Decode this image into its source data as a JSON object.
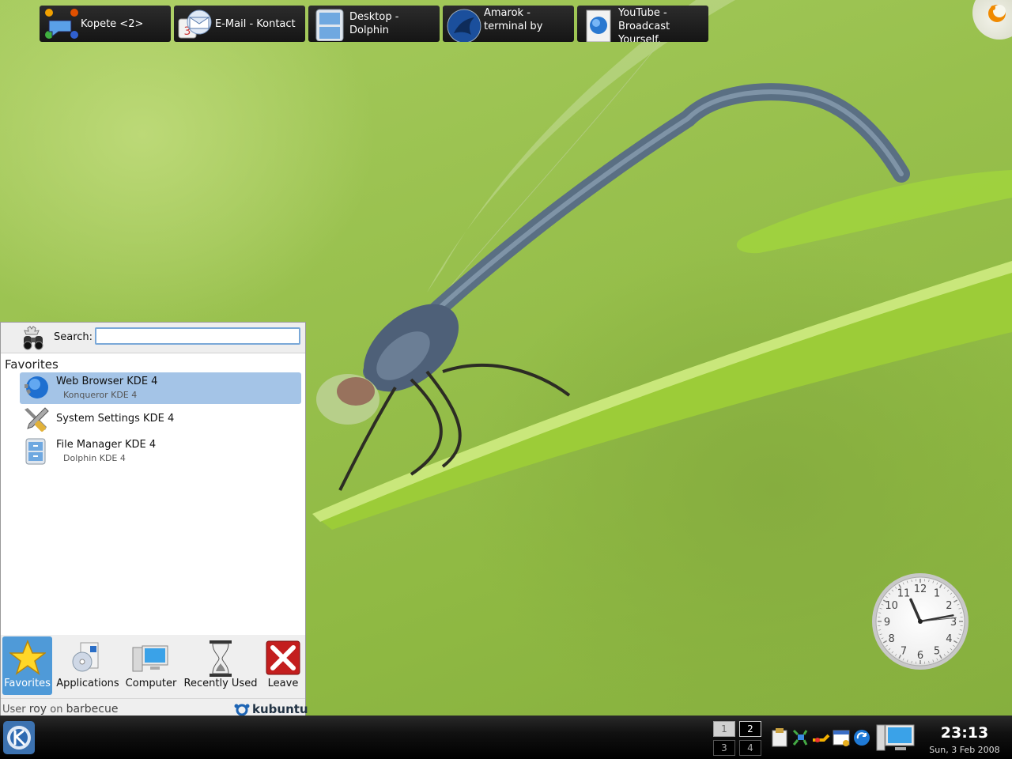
{
  "kickoff": {
    "search_label": "Search:",
    "search_value": "",
    "section_title": "Favorites",
    "favorites": [
      {
        "title": "Web Browser KDE 4",
        "subtitle": "Konqueror KDE 4",
        "icon": "globe-icon",
        "selected": true
      },
      {
        "title": "System Settings KDE 4",
        "subtitle": "",
        "icon": "settings-tools-icon",
        "selected": false
      },
      {
        "title": "File Manager KDE 4",
        "subtitle": "Dolphin KDE 4",
        "icon": "file-cabinet-icon",
        "selected": false
      }
    ],
    "tabs": [
      {
        "label": "Favorites",
        "icon": "star-icon",
        "active": true
      },
      {
        "label": "Applications",
        "icon": "applications-icon",
        "active": false
      },
      {
        "label": "Computer",
        "icon": "computer-icon",
        "active": false
      },
      {
        "label": "Recently Used",
        "icon": "hourglass-icon",
        "active": false
      },
      {
        "label": "Leave",
        "icon": "leave-icon",
        "active": false
      }
    ],
    "user_prefix": "User",
    "user_name": "roy",
    "user_on": "on",
    "host_name": "barbecue",
    "brand": "kubuntu"
  },
  "taskbar": {
    "tasks": [
      {
        "label": "Kopete <2>",
        "icon": "kopete-icon"
      },
      {
        "label": "E-Mail - Kontact",
        "icon": "kontact-icon"
      },
      {
        "label": "Desktop - Dolphin",
        "icon": "dolphin-icon"
      },
      {
        "label": "Amarok - terminal by",
        "icon": "amarok-icon"
      },
      {
        "label": "YouTube - Broadcast Yourself.",
        "icon": "konqueror-icon"
      }
    ],
    "pager": [
      "1",
      "2",
      "3",
      "4"
    ],
    "tray_icons": [
      "klipper-icon",
      "network-icon",
      "wireless-icon",
      "calendar-icon",
      "update-icon"
    ],
    "clock_time": "23:13",
    "clock_date": "Sun, 3 Feb 2008"
  },
  "desktop": {
    "clock_numbers": [
      "12",
      "1",
      "2",
      "3",
      "4",
      "5",
      "6",
      "7",
      "8",
      "9",
      "10",
      "11"
    ],
    "clock_hour": 11,
    "clock_minute": 13,
    "clock_second": 14
  },
  "colors": {
    "selection": "#a4c4e7",
    "active_tab": "#4f9ad8",
    "panel": "#111111"
  }
}
